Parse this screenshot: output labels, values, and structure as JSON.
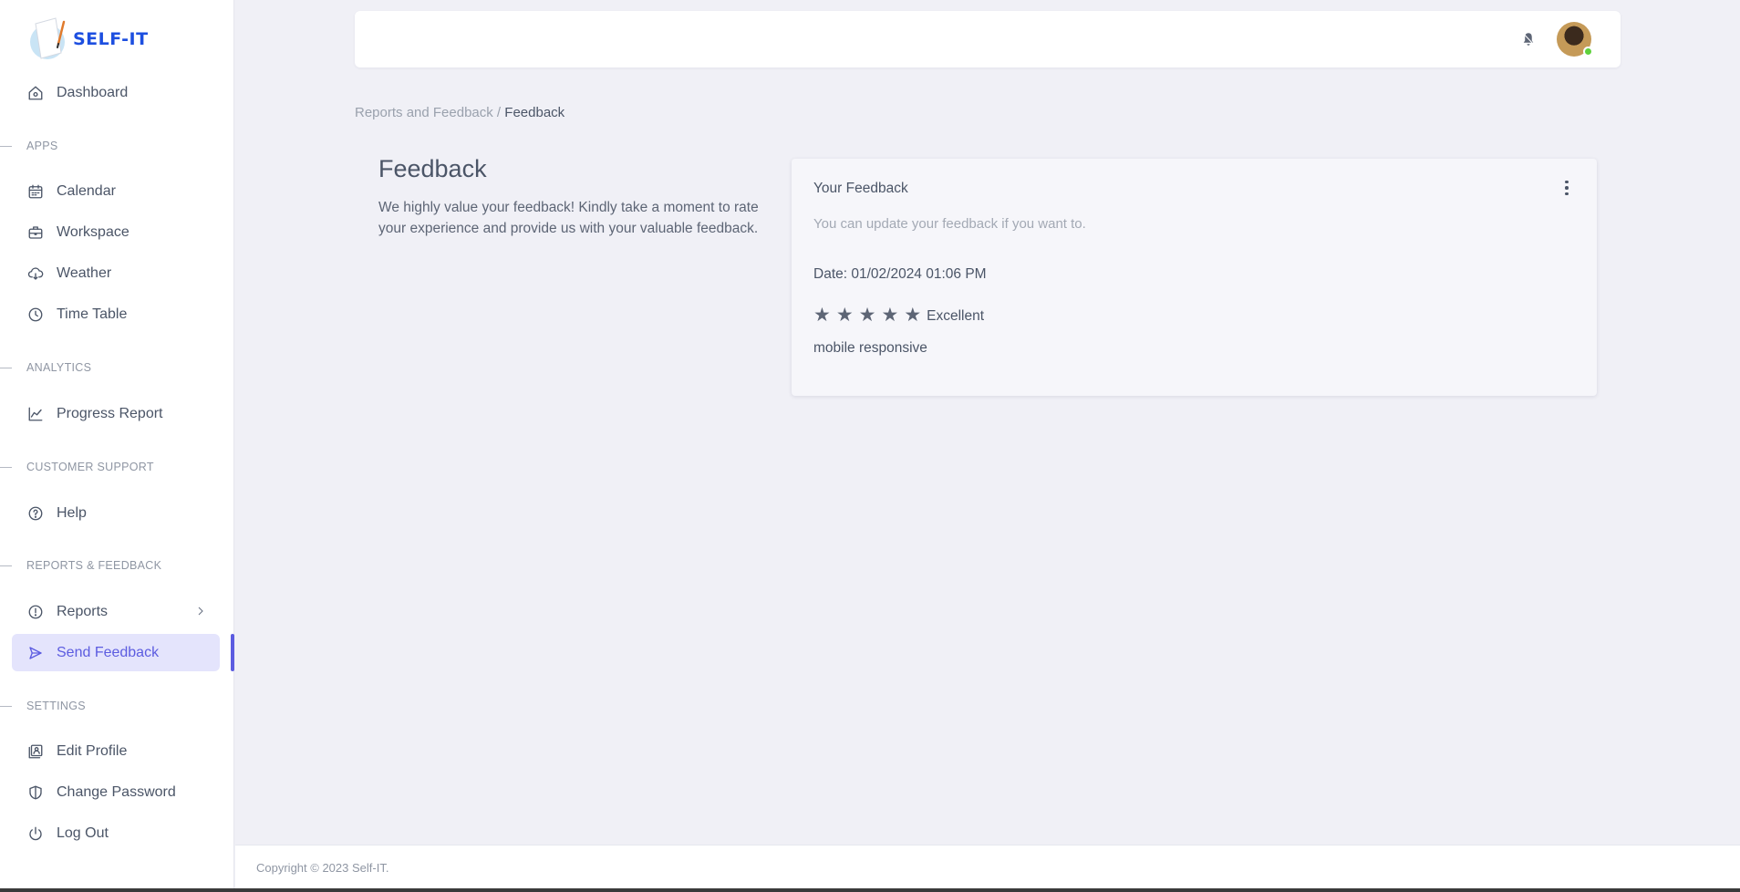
{
  "brand": {
    "name": "SELF-IT",
    "accent": "#5c5ce0",
    "logo_color": "#1d4fe0"
  },
  "sidebar": {
    "dashboard": {
      "label": "Dashboard",
      "icon": "home-icon"
    },
    "sections": [
      {
        "title": "APPS",
        "items": [
          {
            "label": "Calendar",
            "icon": "calendar-icon"
          },
          {
            "label": "Workspace",
            "icon": "briefcase-icon"
          },
          {
            "label": "Weather",
            "icon": "cloud-icon"
          },
          {
            "label": "Time Table",
            "icon": "clock-icon"
          }
        ]
      },
      {
        "title": "ANALYTICS",
        "items": [
          {
            "label": "Progress Report",
            "icon": "chart-line-icon"
          }
        ]
      },
      {
        "title": "CUSTOMER SUPPORT",
        "items": [
          {
            "label": "Help",
            "icon": "question-circle-icon"
          }
        ]
      },
      {
        "title": "REPORTS & FEEDBACK",
        "items": [
          {
            "label": "Reports",
            "icon": "alert-circle-icon",
            "has_submenu": true
          },
          {
            "label": "Send Feedback",
            "icon": "send-icon",
            "active": true
          }
        ]
      },
      {
        "title": "SETTINGS",
        "items": [
          {
            "label": "Edit Profile",
            "icon": "profile-card-icon"
          },
          {
            "label": "Change Password",
            "icon": "shield-icon"
          },
          {
            "label": "Log Out",
            "icon": "power-icon"
          }
        ]
      }
    ]
  },
  "header": {
    "bell_icon": "bell-icon",
    "avatar_status": "online"
  },
  "breadcrumb": {
    "parent": "Reports and Feedback",
    "separator": " / ",
    "current": "Feedback"
  },
  "intro": {
    "title": "Feedback",
    "description": "We highly value your feedback! Kindly take a moment to rate your experience and provide us with your valuable feedback."
  },
  "feedback_card": {
    "title": "Your Feedback",
    "subtitle": "You can update your feedback if you want to.",
    "date": "Date: 01/02/2024 01:06 PM",
    "rating_value": 5,
    "rating_max": 5,
    "rating_label": "Excellent",
    "comment": "mobile responsive"
  },
  "footer": {
    "copyright": "Copyright © 2023 Self-IT."
  }
}
